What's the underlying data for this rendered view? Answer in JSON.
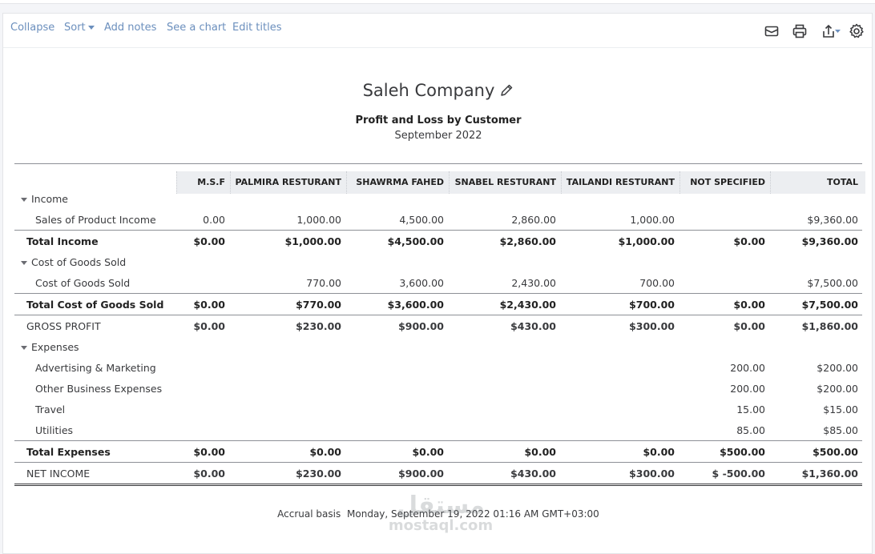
{
  "toolbar": {
    "collapse": "Collapse",
    "sort": "Sort",
    "add_notes": "Add notes",
    "see_chart": "See a chart",
    "edit_titles": "Edit titles",
    "icons": [
      "email-icon",
      "print-icon",
      "export-icon",
      "settings-icon"
    ]
  },
  "report": {
    "company": "Saleh Company",
    "title": "Profit and Loss by Customer",
    "period": "September 2022"
  },
  "columns": [
    "M.S.F",
    "PALMIRA RESTURANT",
    "SHAWRMA FAHED",
    "SNABEL RESTURANT",
    "TAILANDI RESTURANT",
    "NOT SPECIFIED",
    "TOTAL"
  ],
  "rows": [
    {
      "label": "Income",
      "type": "section",
      "values": [
        "",
        "",
        "",
        "",
        "",
        "",
        ""
      ]
    },
    {
      "label": "Sales of Product Income",
      "type": "item",
      "values": [
        "0.00",
        "1,000.00",
        "4,500.00",
        "2,860.00",
        "1,000.00",
        "",
        "$9,360.00"
      ]
    },
    {
      "label": "Total Income",
      "type": "total",
      "values": [
        "$0.00",
        "$1,000.00",
        "$4,500.00",
        "$2,860.00",
        "$1,000.00",
        "$0.00",
        "$9,360.00"
      ]
    },
    {
      "label": "Cost of Goods Sold",
      "type": "section",
      "values": [
        "",
        "",
        "",
        "",
        "",
        "",
        ""
      ]
    },
    {
      "label": "Cost of Goods Sold",
      "type": "item",
      "values": [
        "",
        "770.00",
        "3,600.00",
        "2,430.00",
        "700.00",
        "",
        "$7,500.00"
      ]
    },
    {
      "label": "Total Cost of Goods Sold",
      "type": "total",
      "values": [
        "$0.00",
        "$770.00",
        "$3,600.00",
        "$2,430.00",
        "$700.00",
        "$0.00",
        "$7,500.00"
      ]
    },
    {
      "label": "GROSS PROFIT",
      "type": "summary",
      "values": [
        "$0.00",
        "$230.00",
        "$900.00",
        "$430.00",
        "$300.00",
        "$0.00",
        "$1,860.00"
      ]
    },
    {
      "label": "Expenses",
      "type": "section",
      "values": [
        "",
        "",
        "",
        "",
        "",
        "",
        ""
      ]
    },
    {
      "label": "Advertising & Marketing",
      "type": "item",
      "values": [
        "",
        "",
        "",
        "",
        "",
        "200.00",
        "$200.00"
      ]
    },
    {
      "label": "Other Business Expenses",
      "type": "item",
      "values": [
        "",
        "",
        "",
        "",
        "",
        "200.00",
        "$200.00"
      ]
    },
    {
      "label": "Travel",
      "type": "item",
      "values": [
        "",
        "",
        "",
        "",
        "",
        "15.00",
        "$15.00"
      ]
    },
    {
      "label": "Utilities",
      "type": "item",
      "values": [
        "",
        "",
        "",
        "",
        "",
        "85.00",
        "$85.00"
      ]
    },
    {
      "label": "Total Expenses",
      "type": "total",
      "values": [
        "$0.00",
        "$0.00",
        "$0.00",
        "$0.00",
        "$0.00",
        "$500.00",
        "$500.00"
      ]
    },
    {
      "label": "NET INCOME",
      "type": "net",
      "values": [
        "$0.00",
        "$230.00",
        "$900.00",
        "$430.00",
        "$300.00",
        "$ -500.00",
        "$1,360.00"
      ]
    }
  ],
  "footer": {
    "basis": "Accrual basis",
    "timestamp": "Monday, September 19, 2022  01:16 AM GMT+03:00"
  },
  "watermark": {
    "arabic": "مستقل",
    "latin": "mostaql.com"
  }
}
